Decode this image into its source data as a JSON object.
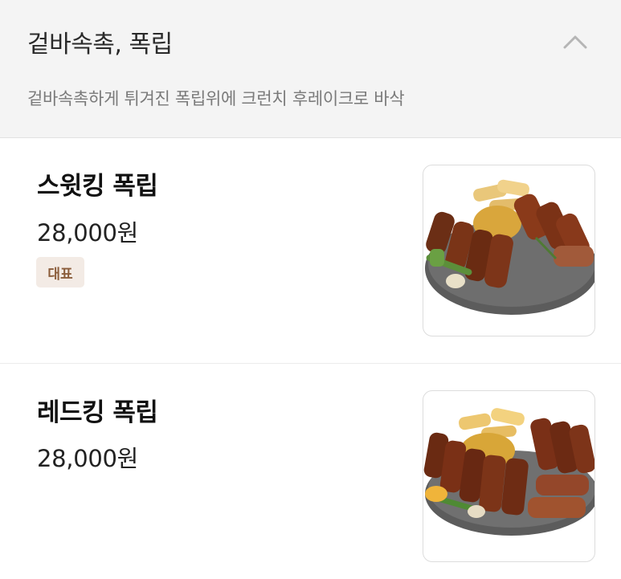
{
  "section": {
    "title": "겉바속촉, 폭립",
    "description": "겉바속촉하게 튀겨진 폭립위에 크런치 후레이크로 바삭",
    "collapse_icon": "chevron-up-icon"
  },
  "menu_items": [
    {
      "name": "스윗킹 폭립",
      "price": "28,000원",
      "badge": "대표",
      "image": "sweet-king-pork-ribs-photo"
    },
    {
      "name": "레드킹 폭립",
      "price": "28,000원",
      "image": "red-king-pork-ribs-photo"
    }
  ],
  "colors": {
    "header_bg": "#f4f4f4",
    "badge_bg": "#f3ebe5",
    "badge_text": "#8b5d3b"
  }
}
